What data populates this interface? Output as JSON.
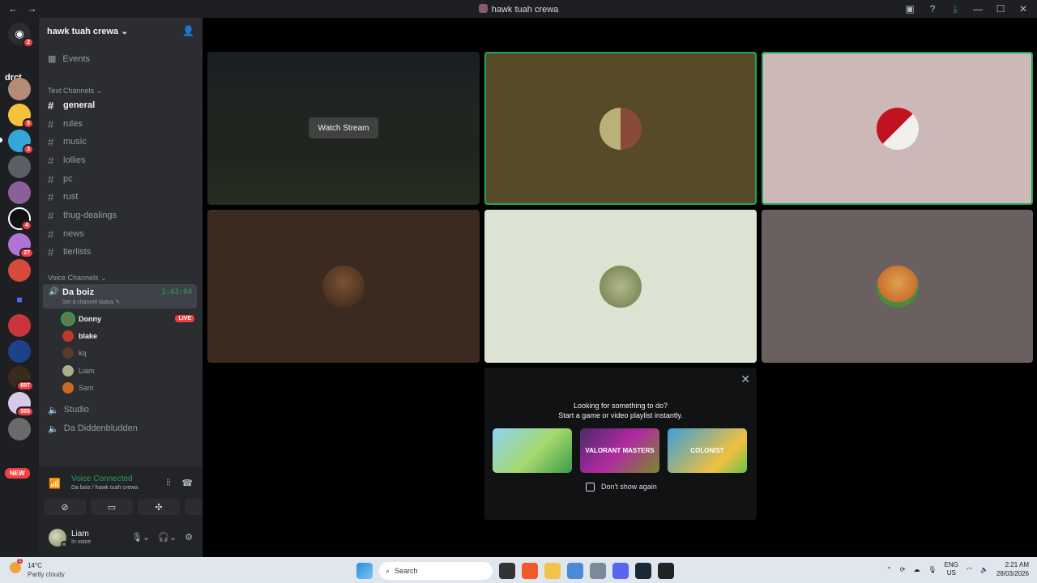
{
  "window": {
    "title": "hawk tuah crewa",
    "back": "←",
    "forward": "→"
  },
  "server": {
    "name": "hawk tuah crewa ⌄",
    "events": "Events"
  },
  "guild_bar": {
    "home_badge": "2",
    "folder_label": "drct",
    "new_label": "NEW",
    "badges": [
      "5",
      "3",
      "4",
      "27",
      "697",
      "565"
    ]
  },
  "categories": {
    "text": "Text Channels ⌄",
    "voice": "Voice Channels ⌄"
  },
  "text_channels": [
    "general",
    "rules",
    "music",
    "lollies",
    "pc",
    "rust",
    "thug-dealings",
    "news",
    "tierlists"
  ],
  "voice": {
    "active_channel": "Da boiz",
    "timer": "1:43:04",
    "status_prompt": "Set a channel status ✎",
    "members": [
      {
        "name": "Donny",
        "live": "LIVE"
      },
      {
        "name": "blake"
      },
      {
        "name": "kq"
      },
      {
        "name": "Liam"
      },
      {
        "name": "Sam"
      }
    ],
    "other_channels": [
      "Studio",
      "Da Diddenbludden"
    ]
  },
  "panel": {
    "voice_connected": "Voice Connected",
    "voice_location": "Da boiz / hawk tuah crewa",
    "user_name": "Liam",
    "user_status": "In voice"
  },
  "stage": {
    "watch_stream": "Watch Stream",
    "tile_colors": [
      "#574a29",
      "#cdb8b8",
      "#3b2a1f",
      "#dde3d2",
      "#6a6060"
    ]
  },
  "suggestion": {
    "line1": "Looking for something to do?",
    "line2": "Start a game or video playlist instantly.",
    "activities": [
      "",
      "VALORANT MASTERS",
      "COLONIST"
    ],
    "dont_show": "Don't show again"
  },
  "taskbar": {
    "temperature": "14°C",
    "weather": "Partly cloudy",
    "weather_badge": "2",
    "search": "Search",
    "lang1": "ENG",
    "lang2": "US",
    "time": "2:21 AM",
    "date": "28/03/2026"
  },
  "icons": [
    "back-icon",
    "forward-icon",
    "discord-icon",
    "add-member-icon",
    "calendar-icon",
    "speaker-icon",
    "signal-icon",
    "disconnect-icon",
    "camera-off-icon",
    "screen-share-icon",
    "activity-icon",
    "soundboard-icon",
    "mic-icon",
    "headphones-icon",
    "gear-icon",
    "close-icon",
    "windows-start-icon",
    "search-icon"
  ]
}
